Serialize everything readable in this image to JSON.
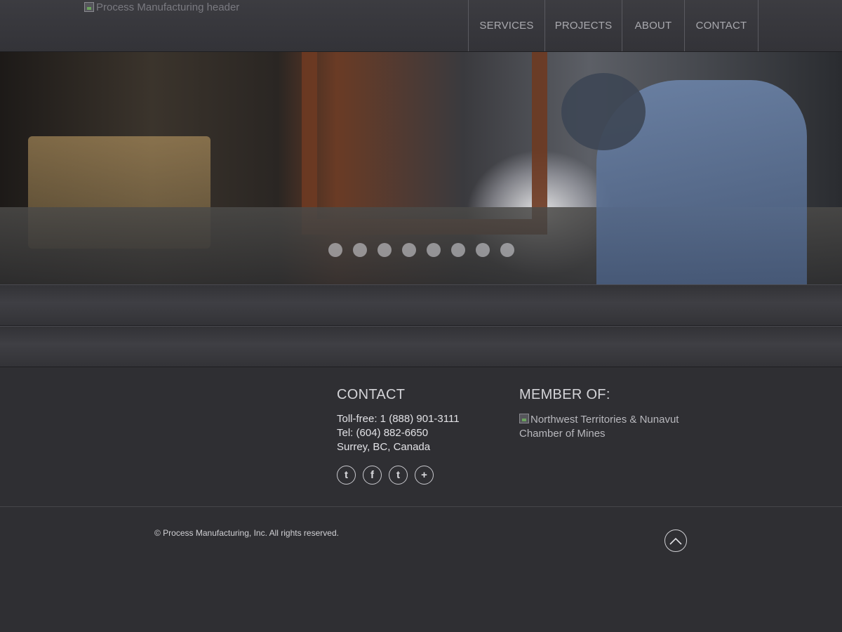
{
  "header": {
    "logo_alt": "Process Manufacturing header",
    "nav": [
      {
        "label": "SERVICES"
      },
      {
        "label": "PROJECTS"
      },
      {
        "label": "ABOUT"
      },
      {
        "label": "CONTACT"
      }
    ]
  },
  "hero": {
    "slide_count": 8,
    "active_slide": 1
  },
  "footer": {
    "contact": {
      "title": "CONTACT",
      "toll_free": "Toll-free: 1 (888) 901-3111",
      "tel": "Tel: (604) 882-6650",
      "location": "Surrey, BC, Canada"
    },
    "member": {
      "title": "MEMBER OF:",
      "logo_alt": "Northwest Territories & Nunavut Chamber of Mines"
    },
    "social_icons": [
      "twitter-icon",
      "facebook-icon",
      "tumblr-icon",
      "plus-icon"
    ],
    "copyright": "© Process Manufacturing, Inc. All rights reserved."
  }
}
